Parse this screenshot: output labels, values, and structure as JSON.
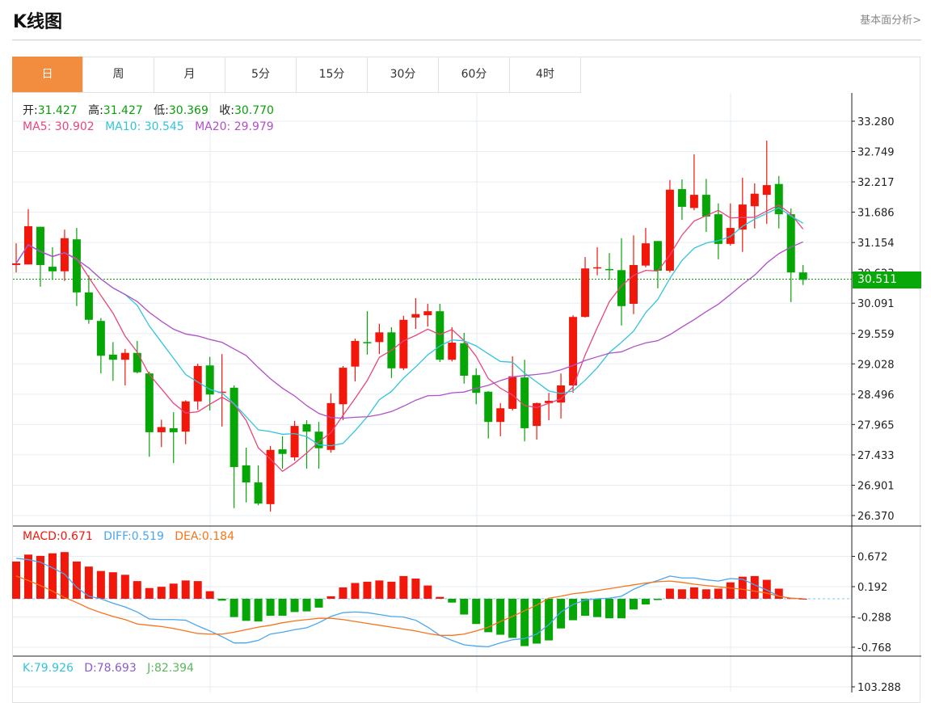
{
  "header": {
    "title": "K线图",
    "fundamental_link": "基本面分析>"
  },
  "tabs": [
    {
      "label": "日",
      "active": true
    },
    {
      "label": "周"
    },
    {
      "label": "月"
    },
    {
      "label": "5分"
    },
    {
      "label": "15分"
    },
    {
      "label": "30分"
    },
    {
      "label": "60分"
    },
    {
      "label": "4时"
    }
  ],
  "ohlc_info": {
    "open_label": "开:",
    "open": "31.427",
    "high_label": "高:",
    "high": "31.427",
    "low_label": "低:",
    "low": "30.369",
    "close_label": "收:",
    "close": "30.770"
  },
  "ma_info": {
    "ma5": "MA5: 30.902",
    "ma10": "MA10: 30.545",
    "ma20": "MA20: 29.979"
  },
  "macd_info": {
    "macd": "MACD:0.671",
    "diff": "DIFF:0.519",
    "dea": "DEA:0.184"
  },
  "kdj_info": {
    "k": "K:79.926",
    "d": "D:78.693",
    "j": "J:82.394"
  },
  "current_price": "30.511",
  "colors": {
    "up": "#f2170b",
    "down": "#05a605",
    "ma5": "#e8457c",
    "ma10": "#33c4dc",
    "ma20": "#b150c8",
    "diff": "#4aa6ee",
    "dea": "#f7741a",
    "tab_active": "#f28c3f"
  },
  "chart_data": {
    "type": "candlestick",
    "price_axis": {
      "ticks": [
        "33.280",
        "32.749",
        "32.217",
        "31.686",
        "31.154",
        "30.623",
        "30.091",
        "29.559",
        "29.028",
        "28.496",
        "27.965",
        "27.433",
        "26.901",
        "26.370"
      ],
      "range": [
        26.37,
        33.28
      ]
    },
    "candles": [
      [
        30.76,
        31.14,
        30.63,
        30.79
      ],
      [
        30.77,
        31.74,
        30.77,
        31.44
      ],
      [
        31.43,
        31.43,
        30.38,
        30.76
      ],
      [
        30.73,
        31.07,
        30.5,
        30.65
      ],
      [
        30.65,
        31.38,
        30.48,
        31.23
      ],
      [
        31.21,
        31.41,
        30.04,
        30.28
      ],
      [
        30.28,
        30.58,
        29.73,
        29.8
      ],
      [
        29.78,
        29.83,
        28.86,
        29.17
      ],
      [
        29.19,
        29.41,
        28.73,
        29.1
      ],
      [
        29.1,
        29.29,
        28.65,
        29.22
      ],
      [
        29.22,
        29.43,
        28.86,
        28.88
      ],
      [
        28.86,
        28.89,
        27.4,
        27.83
      ],
      [
        27.83,
        28.05,
        27.57,
        27.92
      ],
      [
        27.9,
        28.18,
        27.29,
        27.83
      ],
      [
        27.84,
        28.39,
        27.62,
        28.37
      ],
      [
        28.37,
        29.03,
        28.22,
        28.99
      ],
      [
        29.0,
        29.15,
        28.21,
        28.49
      ],
      [
        28.52,
        29.2,
        27.93,
        28.54
      ],
      [
        28.61,
        28.65,
        26.5,
        27.22
      ],
      [
        27.25,
        27.56,
        26.6,
        26.95
      ],
      [
        26.95,
        27.25,
        26.55,
        26.58
      ],
      [
        26.57,
        27.59,
        26.44,
        27.52
      ],
      [
        27.53,
        27.76,
        27.19,
        27.45
      ],
      [
        27.39,
        28.03,
        27.33,
        27.94
      ],
      [
        27.97,
        28.04,
        27.19,
        27.84
      ],
      [
        27.84,
        28.01,
        27.19,
        27.55
      ],
      [
        27.52,
        28.51,
        27.47,
        28.34
      ],
      [
        28.32,
        28.99,
        28.04,
        28.96
      ],
      [
        28.98,
        29.47,
        28.72,
        29.43
      ],
      [
        29.41,
        29.95,
        29.19,
        29.4
      ],
      [
        29.41,
        29.73,
        29.2,
        29.58
      ],
      [
        29.58,
        29.67,
        28.78,
        28.95
      ],
      [
        28.95,
        29.87,
        28.92,
        29.8
      ],
      [
        29.84,
        30.18,
        29.64,
        29.9
      ],
      [
        29.88,
        30.08,
        29.68,
        29.95
      ],
      [
        29.95,
        30.08,
        29.06,
        29.1
      ],
      [
        29.1,
        29.67,
        29.07,
        29.4
      ],
      [
        29.39,
        29.57,
        28.68,
        28.82
      ],
      [
        28.83,
        28.95,
        28.32,
        28.52
      ],
      [
        28.54,
        28.55,
        27.72,
        28.01
      ],
      [
        28.01,
        28.34,
        27.76,
        28.25
      ],
      [
        28.24,
        29.16,
        28.21,
        28.81
      ],
      [
        28.79,
        29.1,
        27.67,
        27.9
      ],
      [
        27.94,
        28.35,
        27.7,
        28.34
      ],
      [
        28.34,
        28.52,
        28.04,
        28.38
      ],
      [
        28.35,
        28.86,
        28.07,
        28.65
      ],
      [
        28.65,
        29.88,
        28.52,
        29.85
      ],
      [
        29.85,
        30.9,
        29.84,
        30.7
      ],
      [
        30.7,
        31.07,
        30.58,
        30.72
      ],
      [
        30.69,
        30.97,
        30.5,
        30.67
      ],
      [
        30.67,
        31.23,
        29.7,
        30.04
      ],
      [
        30.08,
        31.28,
        29.9,
        30.76
      ],
      [
        30.75,
        31.41,
        30.72,
        31.14
      ],
      [
        31.18,
        31.18,
        30.35,
        30.66
      ],
      [
        30.66,
        32.25,
        30.63,
        32.08
      ],
      [
        32.09,
        32.26,
        31.55,
        31.78
      ],
      [
        31.76,
        32.7,
        31.72,
        31.99
      ],
      [
        31.99,
        32.27,
        31.34,
        31.61
      ],
      [
        31.65,
        31.84,
        30.86,
        31.13
      ],
      [
        31.13,
        31.84,
        31.1,
        31.41
      ],
      [
        31.38,
        32.29,
        30.99,
        31.82
      ],
      [
        31.79,
        32.19,
        31.4,
        32.01
      ],
      [
        31.99,
        32.94,
        31.48,
        32.16
      ],
      [
        32.18,
        32.32,
        31.4,
        31.65
      ],
      [
        31.65,
        31.75,
        30.11,
        30.63
      ],
      [
        30.63,
        30.76,
        30.41,
        30.5
      ]
    ],
    "macd_axis": {
      "ticks": [
        "0.672",
        "0.192",
        "-0.288",
        "-0.768"
      ]
    },
    "macd_hist": [
      0.59,
      0.7,
      0.68,
      0.72,
      0.74,
      0.59,
      0.51,
      0.44,
      0.42,
      0.38,
      0.28,
      0.17,
      0.19,
      0.24,
      0.29,
      0.28,
      0.12,
      -0.03,
      -0.29,
      -0.35,
      -0.36,
      -0.27,
      -0.27,
      -0.21,
      -0.2,
      -0.14,
      0.04,
      0.18,
      0.25,
      0.27,
      0.29,
      0.27,
      0.36,
      0.32,
      0.21,
      0.03,
      -0.06,
      -0.25,
      -0.4,
      -0.53,
      -0.57,
      -0.62,
      -0.75,
      -0.71,
      -0.66,
      -0.47,
      -0.34,
      -0.27,
      -0.29,
      -0.31,
      -0.31,
      -0.17,
      -0.09,
      -0.02,
      0.16,
      0.15,
      0.18,
      0.15,
      0.16,
      0.26,
      0.35,
      0.36,
      0.3,
      0.16,
      0.01,
      0.0
    ],
    "diff": [
      0.64,
      0.62,
      0.58,
      0.49,
      0.39,
      0.18,
      0.04,
      0.0,
      -0.07,
      -0.13,
      -0.21,
      -0.32,
      -0.33,
      -0.33,
      -0.34,
      -0.43,
      -0.51,
      -0.6,
      -0.7,
      -0.7,
      -0.66,
      -0.56,
      -0.53,
      -0.49,
      -0.46,
      -0.38,
      -0.28,
      -0.22,
      -0.21,
      -0.22,
      -0.25,
      -0.28,
      -0.29,
      -0.34,
      -0.45,
      -0.58,
      -0.66,
      -0.73,
      -0.75,
      -0.76,
      -0.7,
      -0.65,
      -0.63,
      -0.56,
      -0.41,
      -0.21,
      -0.09,
      -0.02,
      0.0,
      0.01,
      0.04,
      0.15,
      0.23,
      0.29,
      0.36,
      0.33,
      0.33,
      0.3,
      0.28,
      0.32,
      0.31,
      0.22,
      0.14,
      0.04,
      0.01,
      0.0
    ],
    "dea": [
      0.36,
      0.29,
      0.21,
      0.12,
      0.02,
      -0.06,
      -0.15,
      -0.22,
      -0.28,
      -0.33,
      -0.4,
      -0.42,
      -0.44,
      -0.47,
      -0.51,
      -0.55,
      -0.56,
      -0.56,
      -0.53,
      -0.49,
      -0.45,
      -0.42,
      -0.38,
      -0.35,
      -0.33,
      -0.31,
      -0.31,
      -0.33,
      -0.36,
      -0.39,
      -0.42,
      -0.45,
      -0.48,
      -0.51,
      -0.55,
      -0.58,
      -0.58,
      -0.56,
      -0.51,
      -0.45,
      -0.36,
      -0.28,
      -0.19,
      -0.1,
      0.01,
      0.04,
      0.08,
      0.1,
      0.13,
      0.16,
      0.19,
      0.22,
      0.25,
      0.27,
      0.28,
      0.26,
      0.23,
      0.21,
      0.19,
      0.17,
      0.15,
      0.12,
      0.09,
      0.04,
      0.01,
      0.0
    ],
    "kdj_axis": {
      "ticks": [
        "103.288"
      ]
    }
  }
}
